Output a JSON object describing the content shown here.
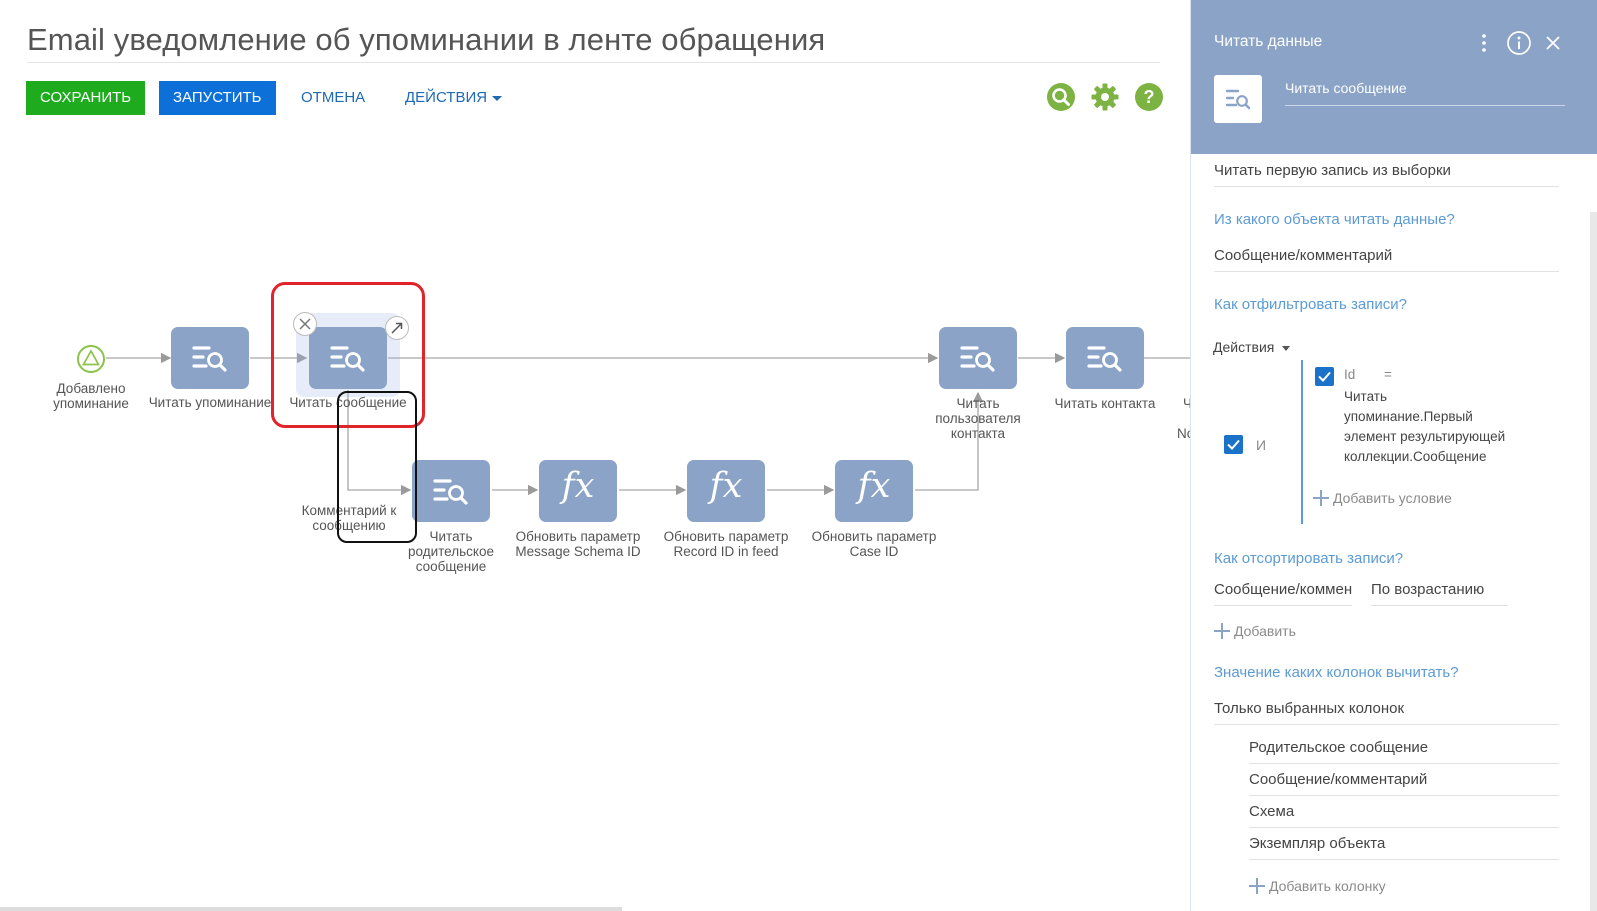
{
  "page": {
    "title": "Email уведомление об упоминании в ленте обращения"
  },
  "toolbar": {
    "save_label": "СОХРАНИТЬ",
    "run_label": "ЗАПУСТИТЬ",
    "cancel_label": "ОТМЕНА",
    "actions_label": "ДЕЙСТВИЯ",
    "icons": [
      "search-icon",
      "gear-icon",
      "help-icon"
    ]
  },
  "diagram": {
    "start_label_1": "Добавлено",
    "start_label_2": "упоминание",
    "nodes": {
      "read_mention": "Читать упоминание",
      "read_message": "Читать сообщение",
      "read_user_1": "Читать",
      "read_user_2": "пользователя",
      "read_user_3": "контакта",
      "read_contact": "Читать контакта",
      "read_parent_1": "Читать",
      "read_parent_2": "родительское",
      "read_parent_3": "сообщение",
      "upd_schema_1": "Обновить параметр",
      "upd_schema_2": "Message Schema ID",
      "upd_record_1": "Обновить параметр",
      "upd_record_2": "Record ID in feed",
      "upd_case_1": "Обновить параметр",
      "upd_case_2": "Case ID",
      "cut_1": "Ч",
      "cut_2": "No"
    },
    "flow_label_1": "Комментарий к",
    "flow_label_2": "сообщению",
    "function_symbol": "fx"
  },
  "panel": {
    "header_title": "Читать данные",
    "element_name": "Читать сообщение",
    "read_mode": "Читать первую запись из выборки",
    "section_object": "Из какого объекта читать данные?",
    "object_value": "Сообщение/комментарий",
    "section_filter": "Как отфильтровать записи?",
    "filter_actions": "Действия",
    "filter_group_op": "И",
    "filter_field": "Id",
    "filter_op": "=",
    "filter_value_lines": [
      "Читать",
      "упоминание.Первый",
      "элемент результирующей",
      "коллекции.Сообщение"
    ],
    "add_condition": "Добавить условие",
    "section_sort": "Как отсортировать записи?",
    "sort_column": "Сообщение/комментарий",
    "sort_direction": "По возрастанию",
    "add_sort": "Добавить",
    "section_columns": "Значение каких колонок вычитать?",
    "columns_mode": "Только выбранных колонок",
    "columns": [
      "Родительское сообщение",
      "Сообщение/комментарий",
      "Схема",
      "Экземпляр объекта"
    ],
    "add_column": "Добавить колонку"
  },
  "colors": {
    "save": "#1eab1e",
    "run": "#0d70d9",
    "node": "#8aa3c7",
    "highlight_red": "#e0242a",
    "section_blue": "#5b9bd5",
    "tool_green": "#7cb342"
  }
}
